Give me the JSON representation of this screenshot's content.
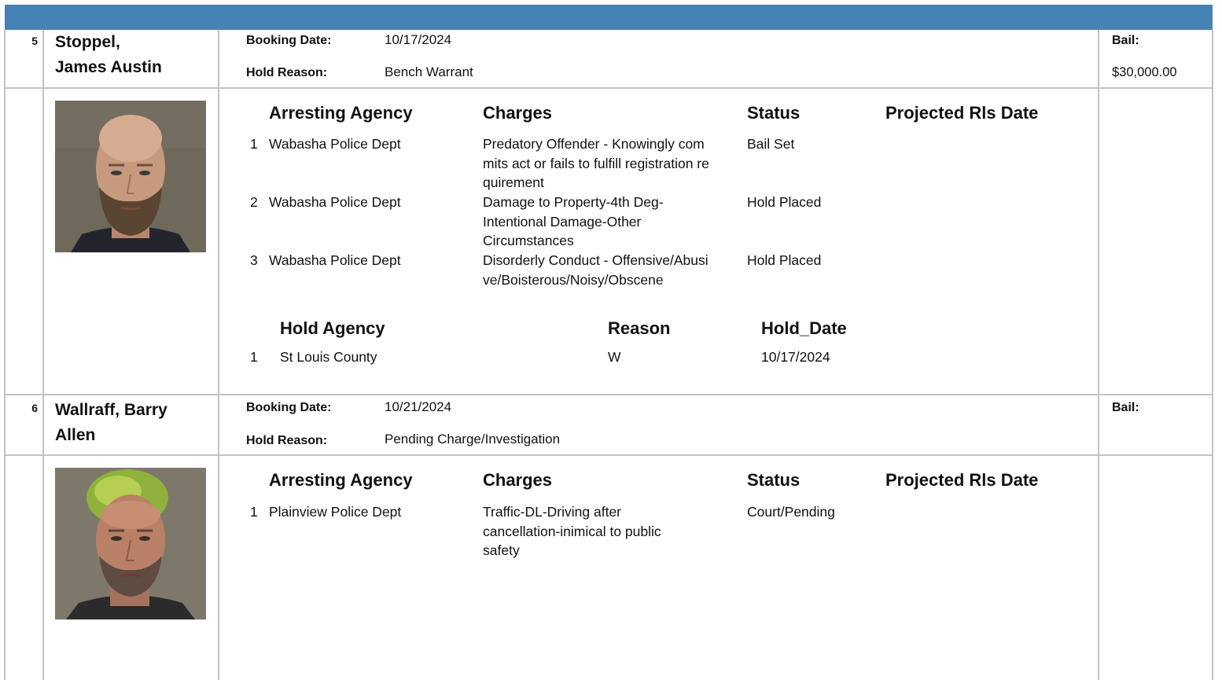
{
  "inmates": [
    {
      "number": "5",
      "name_line1": "Stoppel,",
      "name_line2": "James Austin",
      "booking_date_label": "Booking Date:",
      "booking_date": "10/17/2024",
      "hold_reason_label": "Hold Reason:",
      "hold_reason": "Bench Warrant",
      "bail_label": "Bail:",
      "bail": "$30,000.00",
      "charges_headers": {
        "agency": "Arresting Agency",
        "charges": "Charges",
        "status": "Status",
        "projected": "Projected Rls Date"
      },
      "charges": [
        {
          "index": "1",
          "agency": "Wabasha Police Dept",
          "charge": "Predatory Offender - Knowingly commits act or fails to fulfill registration requirement",
          "status": "Bail Set"
        },
        {
          "index": "2",
          "agency": "Wabasha Police Dept",
          "charge": "Damage to Property-4th Deg-Intentional Damage-Other Circumstances",
          "status": "Hold Placed"
        },
        {
          "index": "3",
          "agency": "Wabasha Police Dept",
          "charge": "Disorderly Conduct - Offensive/Abusive/Boisterous/Noisy/Obscene",
          "status": "Hold Placed"
        }
      ],
      "hold_headers": {
        "agency": "Hold Agency",
        "reason": "Reason",
        "date": "Hold_Date"
      },
      "holds": [
        {
          "index": "1",
          "agency": "St Louis County",
          "reason": "W",
          "date": "10/17/2024"
        }
      ]
    },
    {
      "number": "6",
      "name_line1": "Wallraff, Barry",
      "name_line2": "Allen",
      "booking_date_label": "Booking Date:",
      "booking_date": "10/21/2024",
      "hold_reason_label": "Hold Reason:",
      "hold_reason": "Pending Charge/Investigation",
      "bail_label": "Bail:",
      "bail": "",
      "charges_headers": {
        "agency": "Arresting Agency",
        "charges": "Charges",
        "status": "Status",
        "projected": "Projected Rls Date"
      },
      "charges": [
        {
          "index": "1",
          "agency": "Plainview Police Dept",
          "charge": "Traffic-DL-Driving after cancellation-inimical to public safety",
          "status": "Court/Pending"
        }
      ]
    }
  ],
  "colors": {
    "header_bar": "#4682b4",
    "grid_lines": "#c4c4c4"
  }
}
